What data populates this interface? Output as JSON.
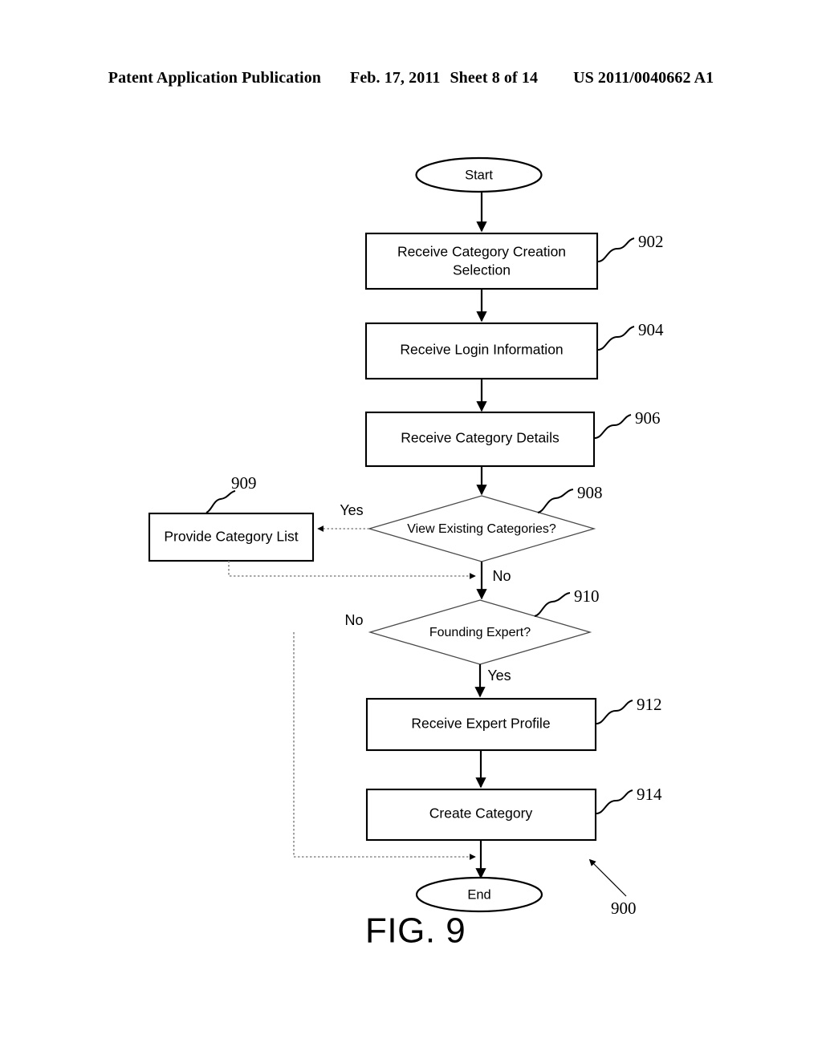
{
  "header": {
    "publication": "Patent Application Publication",
    "date": "Feb. 17, 2011",
    "sheet": "Sheet 8 of 14",
    "patent_number": "US 2011/0040662 A1"
  },
  "figure": {
    "caption": "FIG. 9",
    "figure_ref": "900",
    "nodes": {
      "start": {
        "label": "Start",
        "type": "terminator"
      },
      "n902": {
        "label_line1": "Receive Category Creation",
        "label_line2": "Selection",
        "ref": "902",
        "type": "process"
      },
      "n904": {
        "label": "Receive Login Information",
        "ref": "904",
        "type": "process"
      },
      "n906": {
        "label": "Receive Category Details",
        "ref": "906",
        "type": "process"
      },
      "n908": {
        "label": "View Existing Categories?",
        "ref": "908",
        "type": "decision"
      },
      "n909": {
        "label": "Provide Category List",
        "ref": "909",
        "type": "process"
      },
      "n910": {
        "label": "Founding Expert?",
        "ref": "910",
        "type": "decision"
      },
      "n912": {
        "label": "Receive Expert Profile",
        "ref": "912",
        "type": "process"
      },
      "n914": {
        "label": "Create Category",
        "ref": "914",
        "type": "process"
      },
      "end": {
        "label": "End",
        "type": "terminator"
      }
    },
    "branch_labels": {
      "b908_yes": "Yes",
      "b908_no": "No",
      "b910_no": "No",
      "b910_yes": "Yes"
    }
  },
  "colors": {
    "ink": "#000000",
    "decision_stroke": "#4a4a4a",
    "loop_stroke": "#8a8a8a",
    "paper": "#ffffff"
  }
}
